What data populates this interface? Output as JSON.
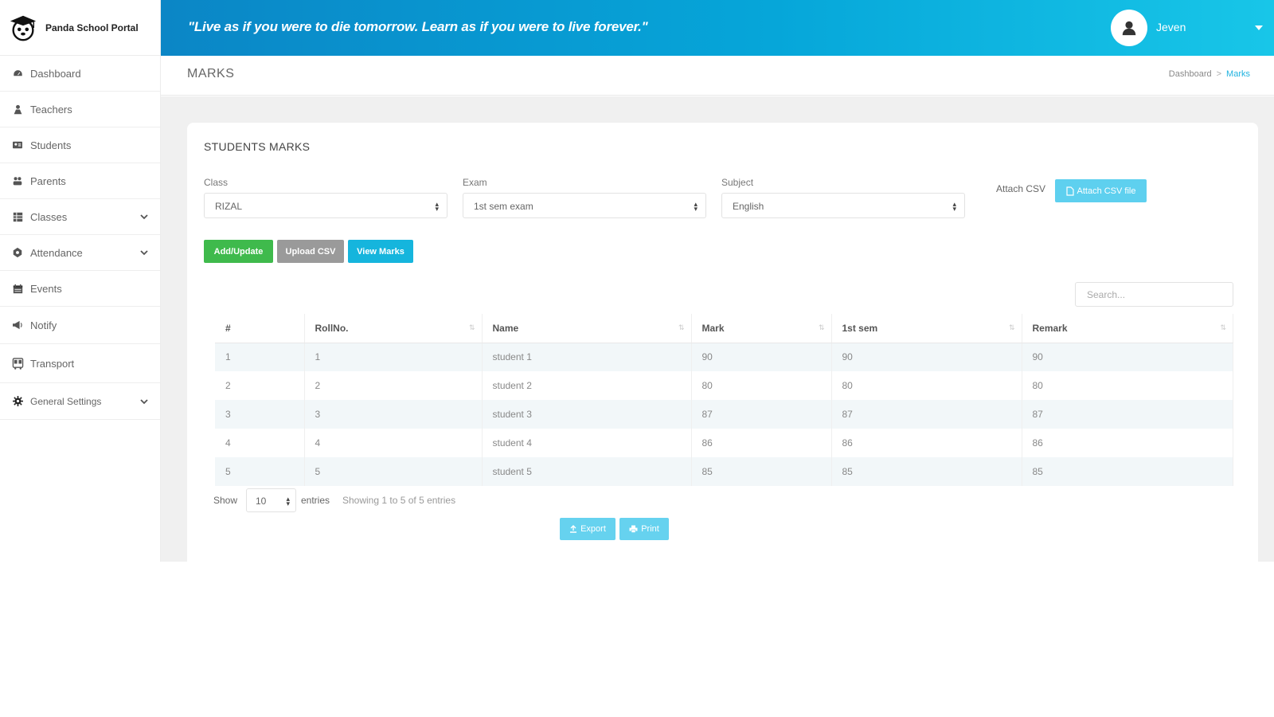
{
  "brand": {
    "name": "Panda School Portal",
    "logo_icon": "graduation-cap-icon"
  },
  "header": {
    "quote": "\"Live as if you were to die tomorrow. Learn as if you were to live forever.\"",
    "user_name": "Jeven",
    "gradient_colors": [
      "#0b86c6",
      "#18c6e8"
    ]
  },
  "sidebar": {
    "items": [
      {
        "label": "Dashboard",
        "icon": "dashboard-icon",
        "expandable": false
      },
      {
        "label": "Teachers",
        "icon": "teacher-icon",
        "expandable": false
      },
      {
        "label": "Students",
        "icon": "students-icon",
        "expandable": false
      },
      {
        "label": "Parents",
        "icon": "parents-icon",
        "expandable": false
      },
      {
        "label": "Classes",
        "icon": "classes-icon",
        "expandable": true
      },
      {
        "label": "Attendance",
        "icon": "attendance-icon",
        "expandable": true
      },
      {
        "label": "Events",
        "icon": "calendar-icon",
        "expandable": false
      },
      {
        "label": "Notify",
        "icon": "megaphone-icon",
        "expandable": false
      },
      {
        "label": "Transport",
        "icon": "bus-icon",
        "expandable": false
      },
      {
        "label": "General Settings",
        "icon": "gear-icon",
        "expandable": true
      }
    ]
  },
  "page": {
    "title": "MARKS",
    "breadcrumb": {
      "home": "Dashboard",
      "separator": ">",
      "current": "Marks"
    }
  },
  "card": {
    "title": "STUDENTS MARKS",
    "filters": {
      "class": {
        "label": "Class",
        "value": "RIZAL"
      },
      "exam": {
        "label": "Exam",
        "value": "1st sem exam"
      },
      "subject": {
        "label": "Subject",
        "value": "English"
      }
    },
    "attach_label": "Attach CSV",
    "attach_button": "Attach CSV file",
    "buttons": {
      "add_update": "Add/Update",
      "upload_csv": "Upload CSV",
      "view_marks": "View Marks"
    },
    "search_placeholder": "Search...",
    "table": {
      "columns": [
        "#",
        "RollNo.",
        "Name",
        "Mark",
        "1st sem",
        "Remark"
      ],
      "rows": [
        [
          "1",
          "1",
          "student 1",
          "90",
          "90",
          "90"
        ],
        [
          "2",
          "2",
          "student 2",
          "80",
          "80",
          "80"
        ],
        [
          "3",
          "3",
          "student 3",
          "87",
          "87",
          "87"
        ],
        [
          "4",
          "4",
          "student 4",
          "86",
          "86",
          "86"
        ],
        [
          "5",
          "5",
          "student 5",
          "85",
          "85",
          "85"
        ]
      ]
    },
    "footer": {
      "show_label": "Show",
      "entries_value": "10",
      "entries_label": "entries",
      "info": "Showing 1 to 5 of 5 entries",
      "export_button": "Export",
      "print_button": "Print"
    }
  },
  "colors": {
    "add_button": "#3fba4c",
    "upload_button": "#9a9a9a",
    "view_button": "#15b5dd",
    "light_button": "#66d2ef",
    "active_crumb": "#20b3e0"
  }
}
